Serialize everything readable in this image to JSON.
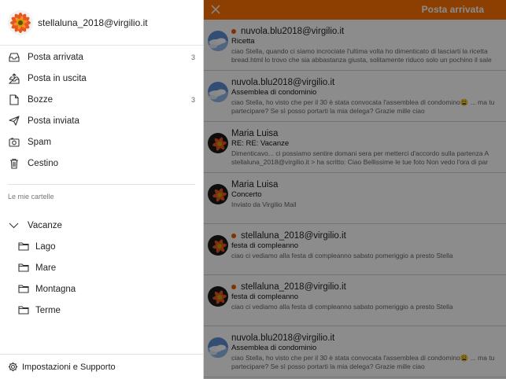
{
  "account": {
    "email": "stellaluna_2018@virgilio.it",
    "avatar_icon": "flower-avatar"
  },
  "folders": [
    {
      "label": "Posta arrivata",
      "icon": "inbox-icon",
      "count": "3"
    },
    {
      "label": "Posta in uscita",
      "icon": "outbox-icon",
      "count": ""
    },
    {
      "label": "Bozze",
      "icon": "draft-icon",
      "count": "3"
    },
    {
      "label": "Posta inviata",
      "icon": "send-icon",
      "count": ""
    },
    {
      "label": "Spam",
      "icon": "spam-icon",
      "count": ""
    },
    {
      "label": "Cestino",
      "icon": "trash-icon",
      "count": ""
    }
  ],
  "my_folders": {
    "title": "Le mie cartelle",
    "parent": "Vacanze",
    "children": [
      "Lago",
      "Mare",
      "Montagna",
      "Terme"
    ]
  },
  "footer": {
    "label": "Impostazioni e Supporto"
  },
  "topbar": {
    "title": "Posta arrivata",
    "accent": "#ff7300"
  },
  "messages": [
    {
      "from": "nuvola.blu2018@virgilio.it",
      "unread": true,
      "avatar": "sky",
      "subject": "Ricetta",
      "preview": "ciao Stella, quando ci siamo incrociate l'ultima volta ho dimenticato di lasciarti la ricetta\nbread.html lo trovo che sia abbastanza giusta, solitamente riduco solo un pochino il sale"
    },
    {
      "from": "nuvola.blu2018@virgilio.it",
      "unread": false,
      "avatar": "sky",
      "subject": "Assemblea di condominio",
      "preview": "ciao Stella, ho visto che per il 30 è stata convocata l'assemblea di condomino😩 ... ma tu\npartecipare? Se sì posso portarti la mia delega? Grazie mille ciao"
    },
    {
      "from": "Maria Luisa",
      "unread": false,
      "avatar": "flower",
      "subject": "RE: RE: Vacanze",
      "preview": "Dimenticavo... ci possiamo sentire domani sera per metterci d'accordo sulla partenza A\nstellaluna_2018@virgilio.it > ha scritto: Ciao Bellissime le tue foto Non vedo l'ora di par"
    },
    {
      "from": "Maria Luisa",
      "unread": false,
      "avatar": "flower",
      "subject": "Concerto",
      "preview": "Inviato da Virgilio Mail"
    },
    {
      "from": "stellaluna_2018@virgilio.it",
      "unread": true,
      "avatar": "flower",
      "subject": "festa di compleanno",
      "preview": "ciao ci vediamo alla festa di compleanno sabato pomeriggio a presto Stella"
    },
    {
      "from": "stellaluna_2018@virgilio.it",
      "unread": true,
      "avatar": "flower",
      "subject": "festa di compleanno",
      "preview": "ciao ci vediamo alla festa di compleanno sabato pomeriggio a presto Stella"
    },
    {
      "from": "nuvola.blu2018@virgilio.it",
      "unread": false,
      "avatar": "sky",
      "subject": "Assemblea di condominio",
      "preview": "ciao Stella, ho visto che per il 30 è stata convocata l'assemblea di condomino😩 ... ma tu\npartecipare? Se sì posso portarti la mia delega? Grazie mille ciao"
    }
  ]
}
